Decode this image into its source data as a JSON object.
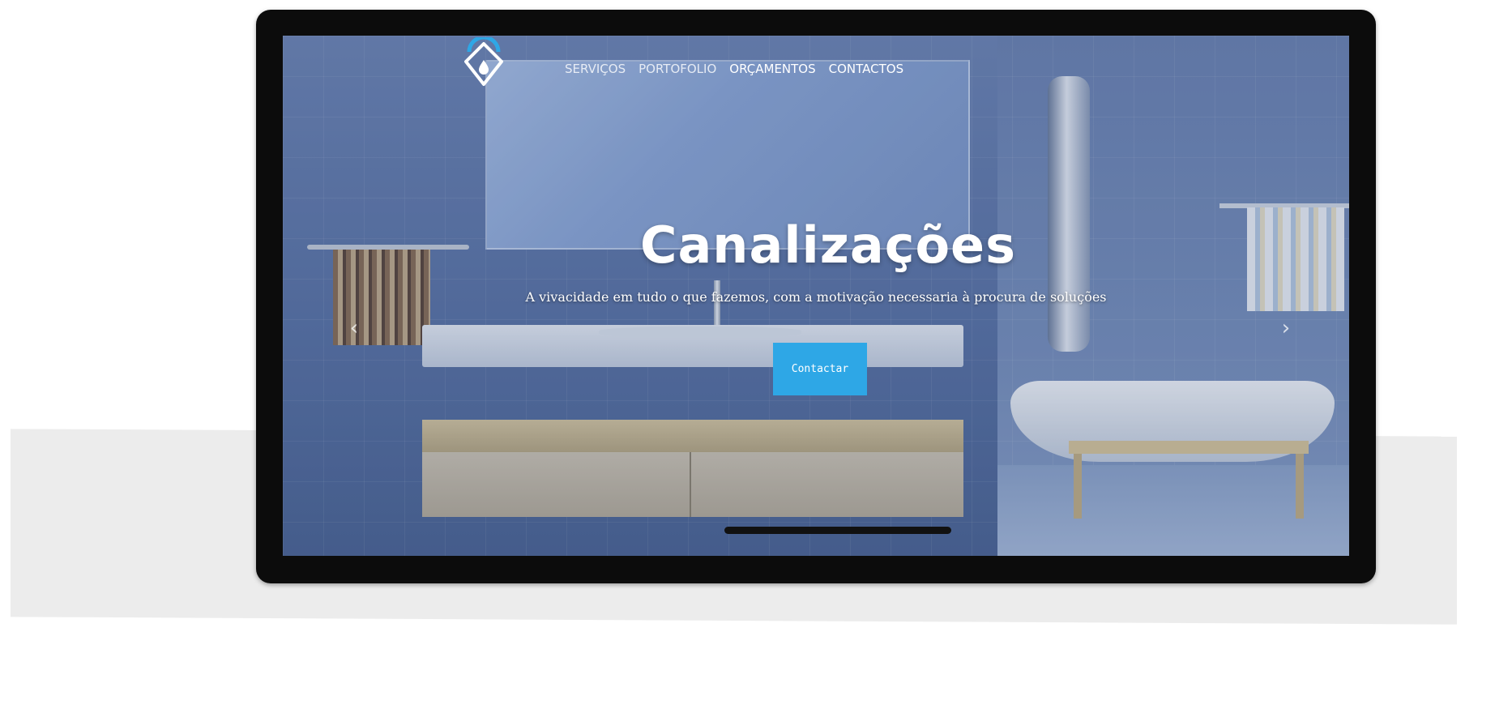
{
  "nav": {
    "items": [
      "SERVIÇOS",
      "PORTOFOLIO",
      "ORÇAMENTOS",
      "CONTACTOS"
    ]
  },
  "hero": {
    "title": "Canalizações",
    "subtitle": "A vivacidade em tudo o que fazemos, com a motivação necessaria à procura de soluções",
    "cta_label": "Contactar"
  },
  "carousel": {
    "prev_icon": "chevron-left-icon",
    "next_icon": "chevron-right-icon",
    "prev_glyph": "‹",
    "next_glyph": "›"
  },
  "colors": {
    "accent": "#2ea7e6",
    "device_frame": "#0c0c0c",
    "backdrop": "#ececec"
  }
}
